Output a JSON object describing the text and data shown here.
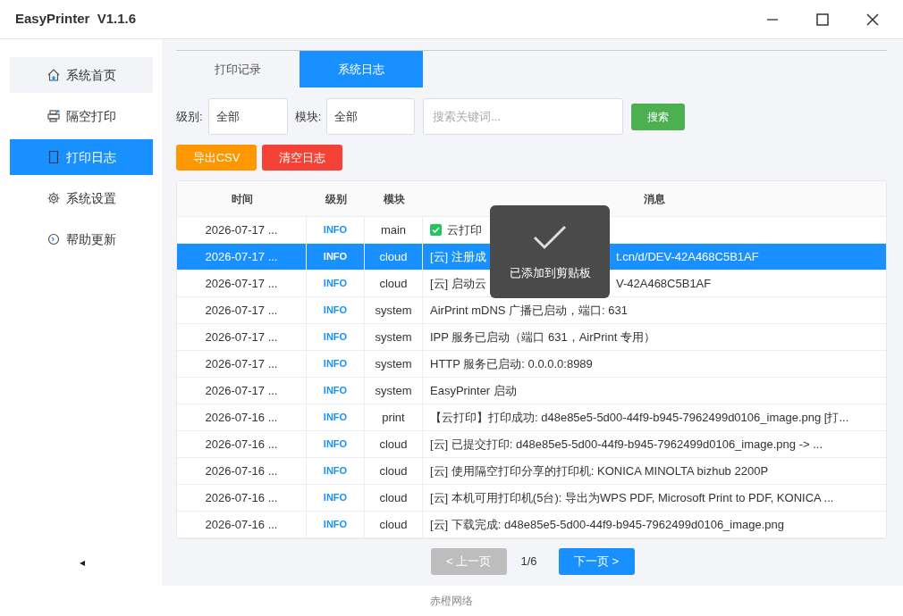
{
  "window": {
    "title": "EasyPrinter  V1.1.6"
  },
  "sidebar": {
    "items": [
      {
        "label": "系统首页",
        "selected": false,
        "kind": "home"
      },
      {
        "label": "隔空打印",
        "selected": false,
        "kind": "printer"
      },
      {
        "label": "打印日志",
        "selected": true,
        "kind": "doc"
      },
      {
        "label": "系统设置",
        "selected": false,
        "kind": "gear"
      },
      {
        "label": "帮助更新",
        "selected": false,
        "kind": "update"
      }
    ]
  },
  "tabs": [
    {
      "label": "打印记录",
      "selected": false
    },
    {
      "label": "系统日志",
      "selected": true
    }
  ],
  "filters": {
    "level_label": "级别:",
    "level_value": "全部",
    "module_label": "模块:",
    "module_value": "全部",
    "search_placeholder": "搜索关键词...",
    "search_button": "搜索"
  },
  "actions": {
    "export": "导出CSV",
    "clear": "清空日志"
  },
  "table": {
    "columns": [
      "时间",
      "级别",
      "模块",
      "消息"
    ],
    "rows": [
      {
        "time": "2026-07-17 ...",
        "level": "INFO",
        "module": "main",
        "message": [
          "云打印"
        ],
        "kind": "success",
        "selected": false
      },
      {
        "time": "2026-07-17 ...",
        "level": "INFO",
        "module": "cloud",
        "message": [
          "[云] 注册成",
          "t.cn/d/DEV-42A468C5B1AF"
        ],
        "kind": "plain",
        "selected": true
      },
      {
        "time": "2026-07-17 ...",
        "level": "INFO",
        "module": "cloud",
        "message": [
          "[云] 启动云",
          "V-42A468C5B1AF"
        ],
        "kind": "plain",
        "selected": false
      },
      {
        "time": "2026-07-17 ...",
        "level": "INFO",
        "module": "system",
        "message": [
          "AirPrint mDNS 广播已启动，端口: 631"
        ],
        "kind": "plain",
        "selected": false
      },
      {
        "time": "2026-07-17 ...",
        "level": "INFO",
        "module": "system",
        "message": [
          "IPP 服务已启动（端口 631，AirPrint 专用）"
        ],
        "kind": "plain",
        "selected": false
      },
      {
        "time": "2026-07-17 ...",
        "level": "INFO",
        "module": "system",
        "message": [
          "HTTP 服务已启动: 0.0.0.0:8989"
        ],
        "kind": "plain",
        "selected": false
      },
      {
        "time": "2026-07-17 ...",
        "level": "INFO",
        "module": "system",
        "message": [
          "EasyPrinter 启动"
        ],
        "kind": "plain",
        "selected": false
      },
      {
        "time": "2026-07-16 ...",
        "level": "INFO",
        "module": "print",
        "message": [
          "【云打印】打印成功: d48e85e5-5d00-44f9-b945-7962499d0106_image.png [打..."
        ],
        "kind": "plain",
        "selected": false
      },
      {
        "time": "2026-07-16 ...",
        "level": "INFO",
        "module": "cloud",
        "message": [
          "[云] 已提交打印: d48e85e5-5d00-44f9-b945-7962499d0106_image.png -> ..."
        ],
        "kind": "plain",
        "selected": false
      },
      {
        "time": "2026-07-16 ...",
        "level": "INFO",
        "module": "cloud",
        "message": [
          "[云] 使用隔空打印分享的打印机: KONICA MINOLTA bizhub 2200P"
        ],
        "kind": "plain",
        "selected": false
      },
      {
        "time": "2026-07-16 ...",
        "level": "INFO",
        "module": "cloud",
        "message": [
          "[云] 本机可用打印机(5台): 导出为WPS PDF, Microsoft Print to PDF, KONICA ..."
        ],
        "kind": "plain",
        "selected": false
      },
      {
        "time": "2026-07-16 ...",
        "level": "INFO",
        "module": "cloud",
        "message": [
          "[云] 下载完成: d48e85e5-5d00-44f9-b945-7962499d0106_image.png"
        ],
        "kind": "plain",
        "selected": false
      }
    ]
  },
  "toast": {
    "text": "已添加到剪贴板"
  },
  "pagination": {
    "prev": "< 上一页",
    "prev_disabled": true,
    "page": "1/6",
    "next": "下一页 >",
    "next_disabled": false
  },
  "footer": "赤橙网络"
}
